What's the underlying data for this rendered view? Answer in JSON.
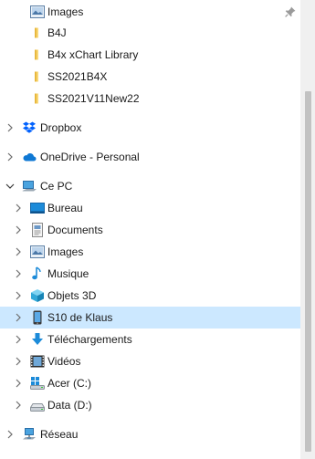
{
  "tree": {
    "quick": [
      {
        "label": "Images",
        "icon": "images-icon",
        "pinned": true
      },
      {
        "label": "B4J",
        "icon": "folder-icon"
      },
      {
        "label": "B4x xChart Library",
        "icon": "folder-icon"
      },
      {
        "label": "SS2021B4X",
        "icon": "folder-icon"
      },
      {
        "label": "SS2021V11New22",
        "icon": "folder-icon"
      }
    ],
    "dropbox": {
      "label": "Dropbox",
      "icon": "dropbox-icon"
    },
    "onedrive": {
      "label": "OneDrive - Personal",
      "icon": "onedrive-icon"
    },
    "thispc": {
      "label": "Ce PC",
      "icon": "computer-icon",
      "expanded": true
    },
    "pc_items": [
      {
        "label": "Bureau",
        "icon": "desktop-icon"
      },
      {
        "label": "Documents",
        "icon": "documents-icon"
      },
      {
        "label": "Images",
        "icon": "images-icon"
      },
      {
        "label": "Musique",
        "icon": "music-icon"
      },
      {
        "label": "Objets 3D",
        "icon": "objects-3d-icon"
      },
      {
        "label": "S10 de Klaus",
        "icon": "phone-icon",
        "selected": true
      },
      {
        "label": "Téléchargements",
        "icon": "downloads-icon"
      },
      {
        "label": "Vidéos",
        "icon": "videos-icon"
      },
      {
        "label": "Acer (C:)",
        "icon": "windows-drive-icon"
      },
      {
        "label": "Data (D:)",
        "icon": "drive-icon"
      }
    ],
    "network": {
      "label": "Réseau",
      "icon": "network-icon"
    }
  },
  "colors": {
    "selection": "#cce8ff",
    "folder": "#f8d775",
    "dropbox": "#0061fe",
    "onedrive": "#0f78d4",
    "scrollbar_thumb": "#c2c2c2"
  }
}
